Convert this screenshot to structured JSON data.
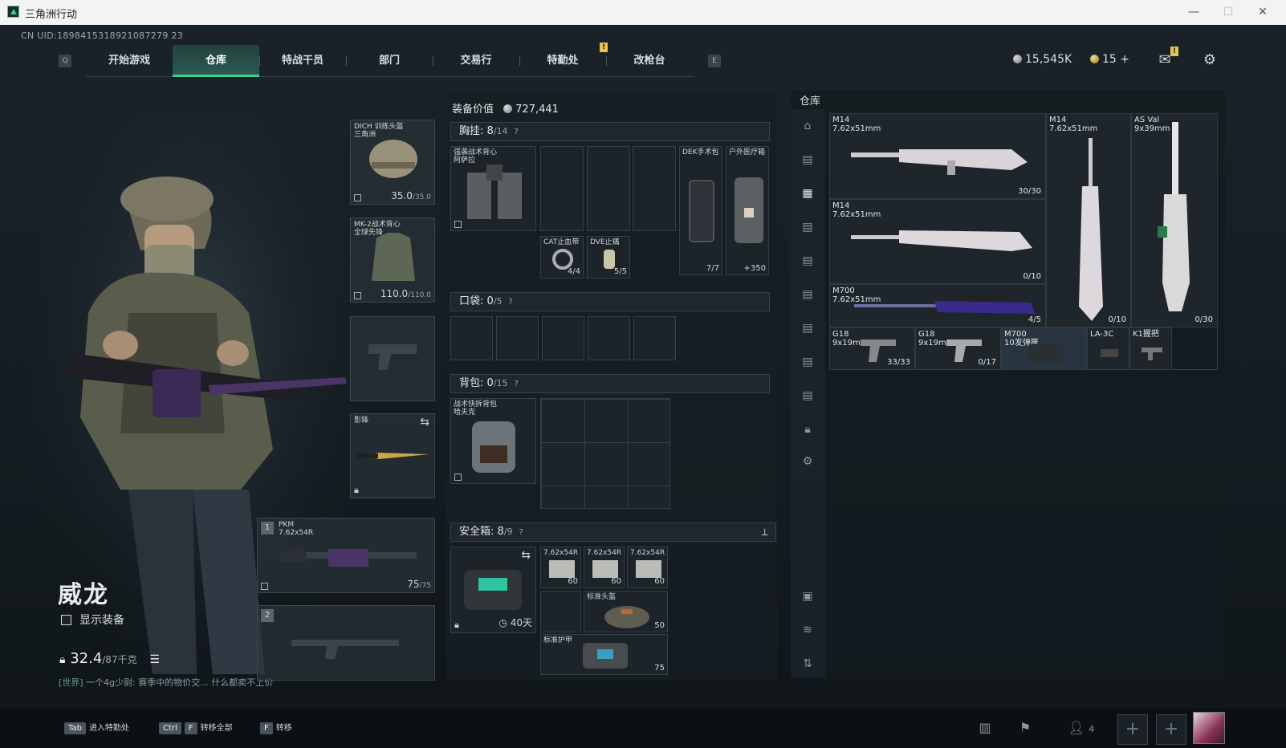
{
  "window": {
    "title": "三角洲行动",
    "min": "—",
    "max": "☐",
    "close": "✕"
  },
  "uid": "CN UID:1898415318921087279 23",
  "keys": {
    "left": "Q",
    "right": "E"
  },
  "nav": {
    "tabs": [
      "开始游戏",
      "仓库",
      "特战干员",
      "部门",
      "交易行",
      "特勤处",
      "改枪台"
    ],
    "active": 1,
    "alert": "!"
  },
  "currency": {
    "silver": "15,545K",
    "gold": "15",
    "plus": "+"
  },
  "operator": {
    "name": "威龙",
    "show_equipment": "显示装备",
    "weight": "32.4",
    "weight_max": "/87千克"
  },
  "chat": {
    "channel": "[世界]",
    "text": "一个4g少尉: 赛季中的物价交... 什么都卖不上价"
  },
  "loadout": {
    "helmet": {
      "name": "DICH 训练头盔",
      "sub": "三角洲",
      "dur": "35.0",
      "max": "/35.0"
    },
    "armor": {
      "name": "MK-2战术背心",
      "sub": "全球先锋",
      "dur": "110.0",
      "max": "/110.0"
    },
    "melee": {
      "name": "影锋"
    },
    "primary": {
      "slot": "1",
      "name": "PKM",
      "cal": "7.62x54R",
      "ammo": "75",
      "max": "/75"
    },
    "secondary": {
      "slot": "2"
    }
  },
  "equip": {
    "label": "装备价值",
    "value": "727,441"
  },
  "chest": {
    "label": "胸挂:",
    "count": "8",
    "max": "/14",
    "q": "?",
    "rig": "强袭战术背心",
    "rig_sub": "阿萨拉",
    "items": [
      {
        "name": "CAT止血带",
        "count": "4/4"
      },
      {
        "name": "DVE止痛",
        "count": "5/5"
      },
      {
        "name": "DEK手术包",
        "count": "7/7"
      },
      {
        "name": "户外医疗箱",
        "count": "+350"
      }
    ]
  },
  "pocket": {
    "label": "口袋:",
    "count": "0",
    "max": "/5",
    "q": "?"
  },
  "backpack": {
    "label": "背包:",
    "count": "0",
    "max": "/15",
    "q": "?",
    "name": "战术快拆背包",
    "sub": "哈夫克"
  },
  "safe": {
    "label": "安全箱:",
    "count": "8",
    "max": "/9",
    "q": "?",
    "days": "40天",
    "items": [
      {
        "name": "7.62x54R",
        "count": "60"
      },
      {
        "name": "7.62x54R",
        "count": "60"
      },
      {
        "name": "7.62x54R",
        "count": "60"
      },
      {
        "name": "标准头盔",
        "count": "50"
      },
      {
        "name": "标准护甲",
        "count": "75"
      }
    ]
  },
  "storage": {
    "title": "仓库",
    "weapons": [
      {
        "name": "M14",
        "cal": "7.62x51mm",
        "count": "30/30"
      },
      {
        "name": "M14",
        "cal": "7.62x51mm",
        "count": "0/10"
      },
      {
        "name": "M14",
        "cal": "7.62x51mm",
        "count": "0/10"
      },
      {
        "name": "AS Val",
        "cal": "9x39mm",
        "count": "0/30"
      },
      {
        "name": "M700",
        "cal": "7.62x51mm",
        "count": "4/5"
      },
      {
        "name": "G18",
        "cal": "9x19mm",
        "count": "33/33"
      },
      {
        "name": "G18",
        "cal": "9x19mm",
        "count": "0/17"
      },
      {
        "name": "M700",
        "cal": "10发弹匣",
        "count": ""
      },
      {
        "name": "LA-3C",
        "cal": "",
        "count": ""
      },
      {
        "name": "K1握把",
        "cal": "",
        "count": ""
      }
    ]
  },
  "bottom": {
    "hints": [
      {
        "key": "Tab",
        "label": "进入特勤处"
      },
      {
        "key": "Ctrl",
        "key2": "F",
        "label": "转移全部"
      },
      {
        "key": "F",
        "label": "转移"
      }
    ],
    "friends": "4",
    "add": "+"
  }
}
